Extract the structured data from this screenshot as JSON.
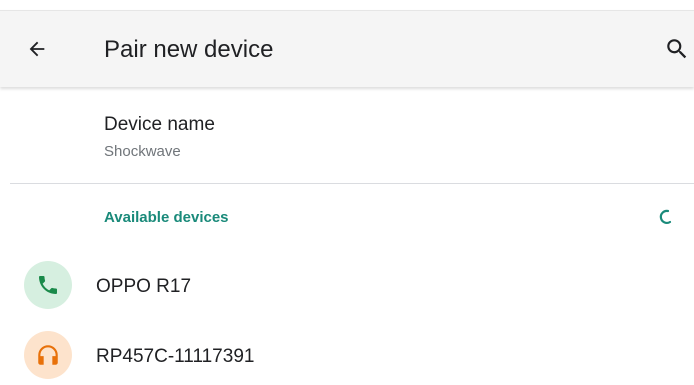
{
  "appbar": {
    "title": "Pair new device",
    "back_icon": "arrow-back-icon",
    "search_icon": "search-icon"
  },
  "device_name": {
    "title": "Device name",
    "value": "Shockwave"
  },
  "available": {
    "header": "Available devices",
    "spinner_icon": "progress-spinner-icon",
    "devices": [
      {
        "label": "OPPO R17",
        "icon": "phone-icon",
        "icon_color": "#1a8a4a",
        "icon_bg": "#d6efe0"
      },
      {
        "label": "RP457C-11117391",
        "icon": "headset-icon",
        "icon_color": "#e8710a",
        "icon_bg": "#fde3cc"
      }
    ]
  },
  "colors": {
    "accent": "#1a8a7a",
    "appbar_bg": "#f5f5f5"
  }
}
